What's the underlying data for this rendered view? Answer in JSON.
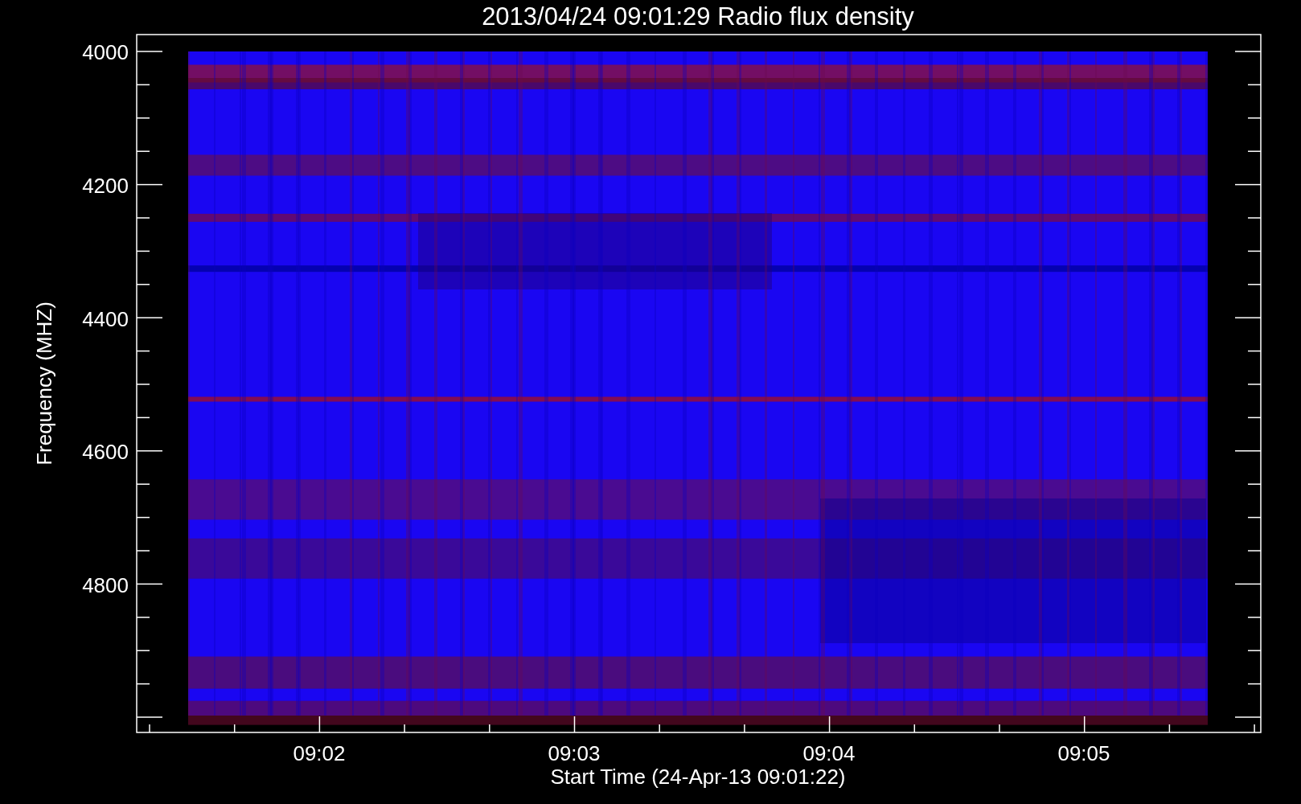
{
  "title": "2013/04/24 09:01:29 Radio flux density",
  "y_axis": {
    "label": "Frequency (MHZ)",
    "ticks": [
      "4000",
      "4200",
      "4400",
      "4600",
      "4800"
    ]
  },
  "x_axis": {
    "label": "Start Time (24-Apr-13 09:01:22)",
    "ticks": [
      "09:02",
      "09:03",
      "09:04",
      "09:05"
    ]
  }
}
